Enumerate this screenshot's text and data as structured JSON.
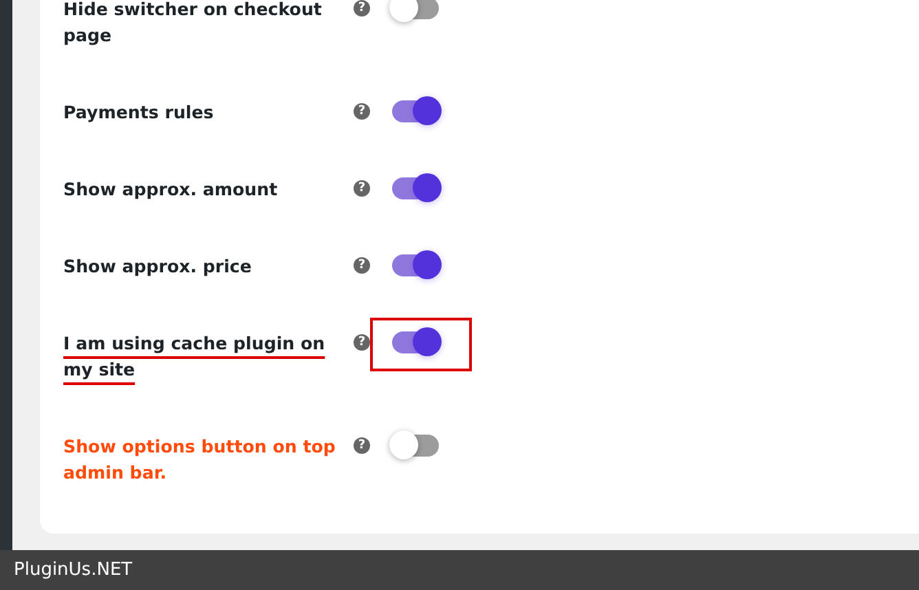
{
  "settings": [
    {
      "label": "Hide switcher on checkout page",
      "help": "?",
      "on": false,
      "warning": false,
      "highlighted": false
    },
    {
      "label": "Payments rules",
      "help": "?",
      "on": true,
      "warning": false,
      "highlighted": false
    },
    {
      "label": "Show approx. amount",
      "help": "?",
      "on": true,
      "warning": false,
      "highlighted": false
    },
    {
      "label": "Show approx. price",
      "help": "?",
      "on": true,
      "warning": false,
      "highlighted": false
    },
    {
      "label": "I am using cache plugin on my site",
      "help": "?",
      "on": true,
      "warning": false,
      "highlighted": true
    },
    {
      "label": "Show options button on top admin bar.",
      "help": "?",
      "on": false,
      "warning": true,
      "highlighted": false
    }
  ],
  "footer": {
    "label": "PluginUs.NET"
  }
}
